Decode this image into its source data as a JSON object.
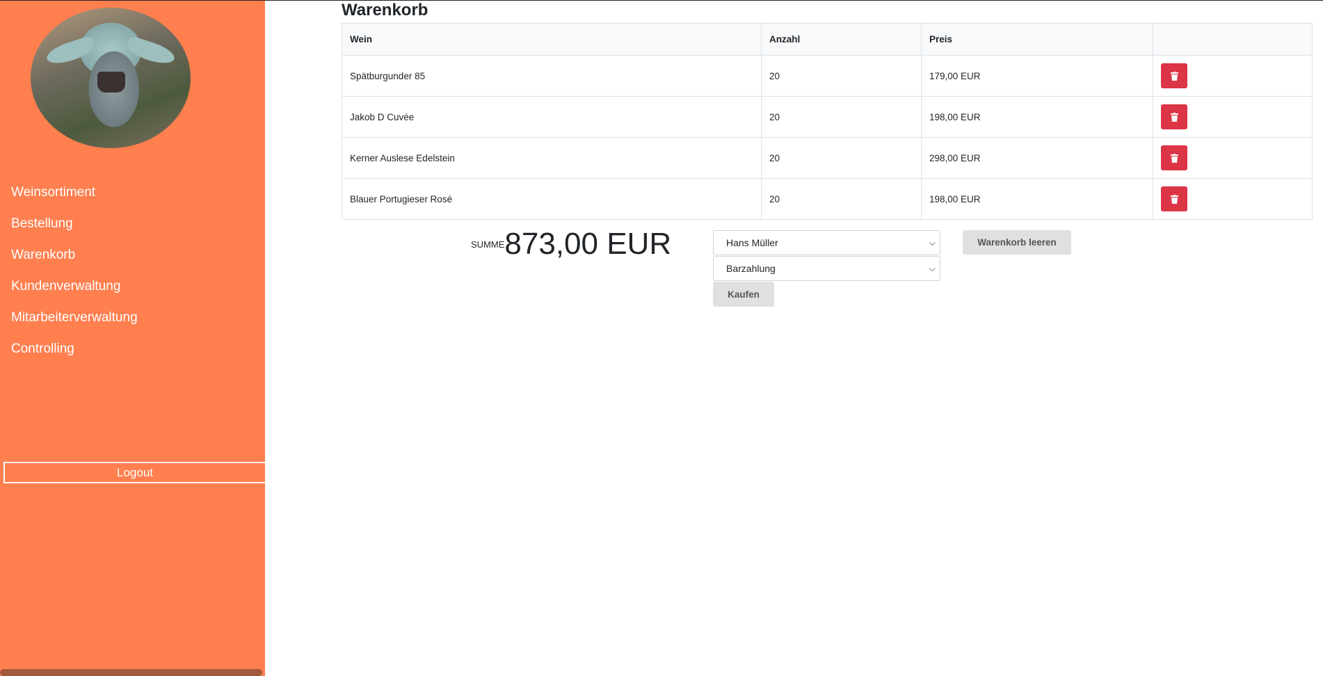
{
  "sidebar": {
    "nav": [
      {
        "label": "Weinsortiment"
      },
      {
        "label": "Bestellung"
      },
      {
        "label": "Warenkorb"
      },
      {
        "label": "Kundenverwaltung"
      },
      {
        "label": "Mitarbeiterverwaltung"
      },
      {
        "label": "Controlling"
      }
    ],
    "logout_label": "Logout"
  },
  "page": {
    "title": "Warenkorb"
  },
  "cart": {
    "columns": [
      "Wein",
      "Anzahl",
      "Preis"
    ],
    "rows": [
      {
        "wine": "Spätburgunder 85",
        "qty": "20",
        "price": "179,00 EUR"
      },
      {
        "wine": "Jakob D Cuvée",
        "qty": "20",
        "price": "198,00 EUR"
      },
      {
        "wine": "Kerner Auslese Edelstein",
        "qty": "20",
        "price": "298,00 EUR"
      },
      {
        "wine": "Blauer Portugieser Rosé",
        "qty": "20",
        "price": "198,00 EUR"
      }
    ],
    "delete_icon": "trash-icon"
  },
  "summary": {
    "label": "SUMME",
    "total": "873,00 EUR",
    "customer_selected": "Hans Müller",
    "payment_selected": "Barzahlung",
    "clear_label": "Warenkorb leeren",
    "buy_label": "Kaufen"
  },
  "colors": {
    "sidebar": "#ff7f4f",
    "danger": "#dc3545"
  }
}
